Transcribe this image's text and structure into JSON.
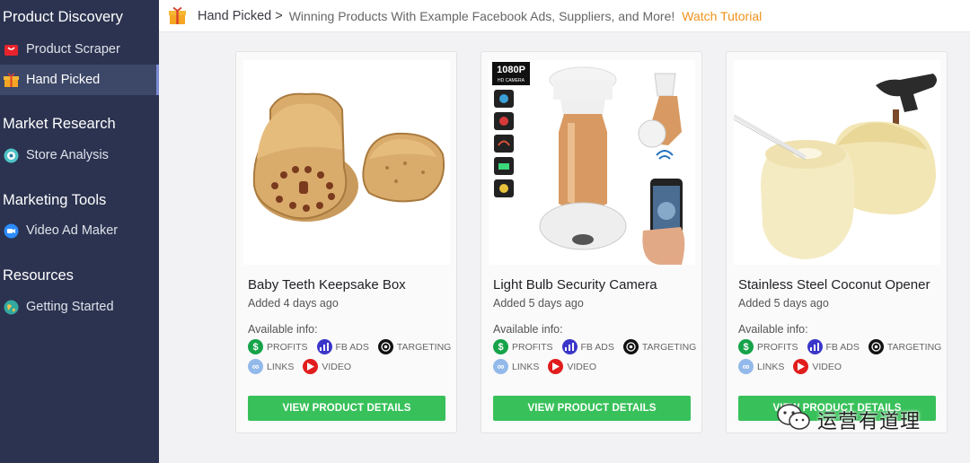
{
  "sidebar": {
    "sections": [
      {
        "title": "Product Discovery",
        "items": [
          {
            "label": "Product Scraper"
          },
          {
            "label": "Hand Picked",
            "active": true
          }
        ]
      },
      {
        "title": "Market Research",
        "items": [
          {
            "label": "Store Analysis"
          }
        ]
      },
      {
        "title": "Marketing Tools",
        "items": [
          {
            "label": "Video Ad Maker"
          }
        ]
      },
      {
        "title": "Resources",
        "items": [
          {
            "label": "Getting Started"
          }
        ]
      }
    ]
  },
  "header": {
    "crumb": "Hand Picked >",
    "subtitle": "Winning Products With Example Facebook Ads, Suppliers, and More!",
    "link": "Watch Tutorial"
  },
  "common": {
    "available_label": "Available info:",
    "tags": {
      "profits": "PROFITS",
      "fb_ads": "FB ADS",
      "targeting": "TARGETING",
      "links": "LINKS",
      "video": "VIDEO"
    },
    "button": "VIEW PRODUCT DETAILS"
  },
  "products": [
    {
      "title": "Baby Teeth Keepsake Box",
      "added": "Added 4 days ago"
    },
    {
      "title": "Light Bulb Security Camera",
      "added": "Added 5 days ago",
      "image_badge": "1080P",
      "image_badge_sub": "HD CAMERA"
    },
    {
      "title": "Stainless Steel Coconut Opener",
      "added": "Added 5 days ago"
    }
  ],
  "watermark": "运营有道理",
  "colors": {
    "sidebar": "#2b3350",
    "accent": "#f0921b",
    "button": "#38c15a"
  }
}
